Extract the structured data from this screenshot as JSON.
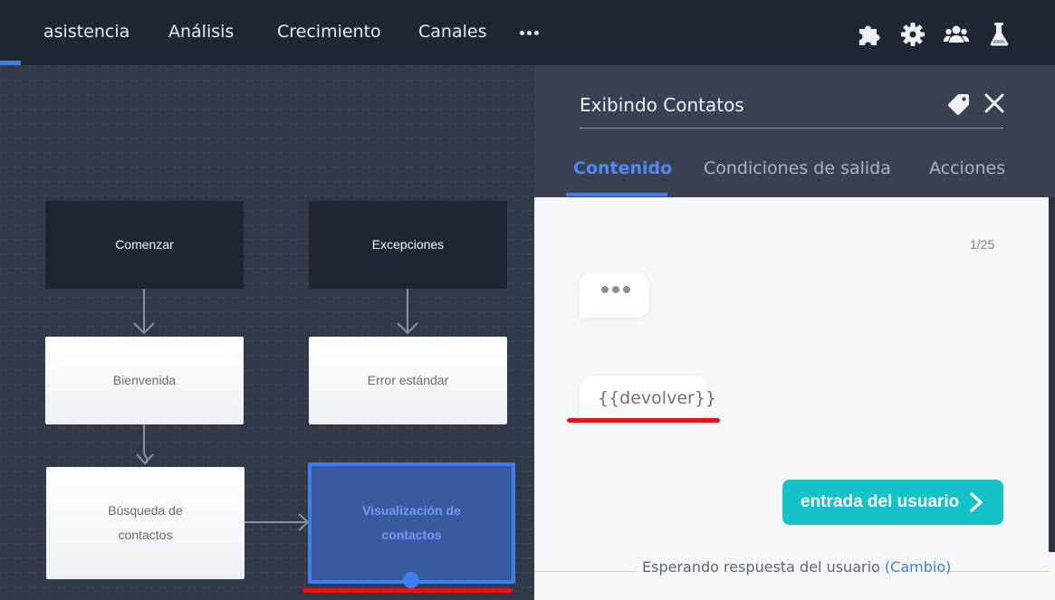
{
  "nav": {
    "items": [
      {
        "label": "asistencia"
      },
      {
        "label": "Análisis"
      },
      {
        "label": "Crecimiento"
      },
      {
        "label": "Canales"
      }
    ],
    "more_icon": "more-horizontal-icon",
    "icons": [
      "puzzle-icon",
      "gear-icon",
      "users-icon",
      "flask-icon"
    ]
  },
  "canvas": {
    "nodes": [
      {
        "label": "Comenzar"
      },
      {
        "label": "Excepciones"
      },
      {
        "label": "Bienvenida"
      },
      {
        "label": "Error estándar"
      },
      {
        "label": "Búsqueda de\ncontactos"
      },
      {
        "label": "Visualización de\ncontactos",
        "selected": true
      }
    ]
  },
  "panel": {
    "title": "Exibindo Contatos",
    "tabs": [
      {
        "label": "Contenido",
        "active": true
      },
      {
        "label": "Condiciones de salida"
      },
      {
        "label": "Acciones"
      }
    ],
    "counter": "1/25",
    "variable_message": "{{devolver}}",
    "user_input_button": "entrada del usuario",
    "footer": {
      "text": "Esperando respuesta del usuario",
      "link": "(Cambio)"
    }
  },
  "colors": {
    "accent": "#3d7ef5",
    "teal_button": "#14c3c7",
    "highlight_red": "#e5141c",
    "nav_bg": "#1f2634"
  }
}
